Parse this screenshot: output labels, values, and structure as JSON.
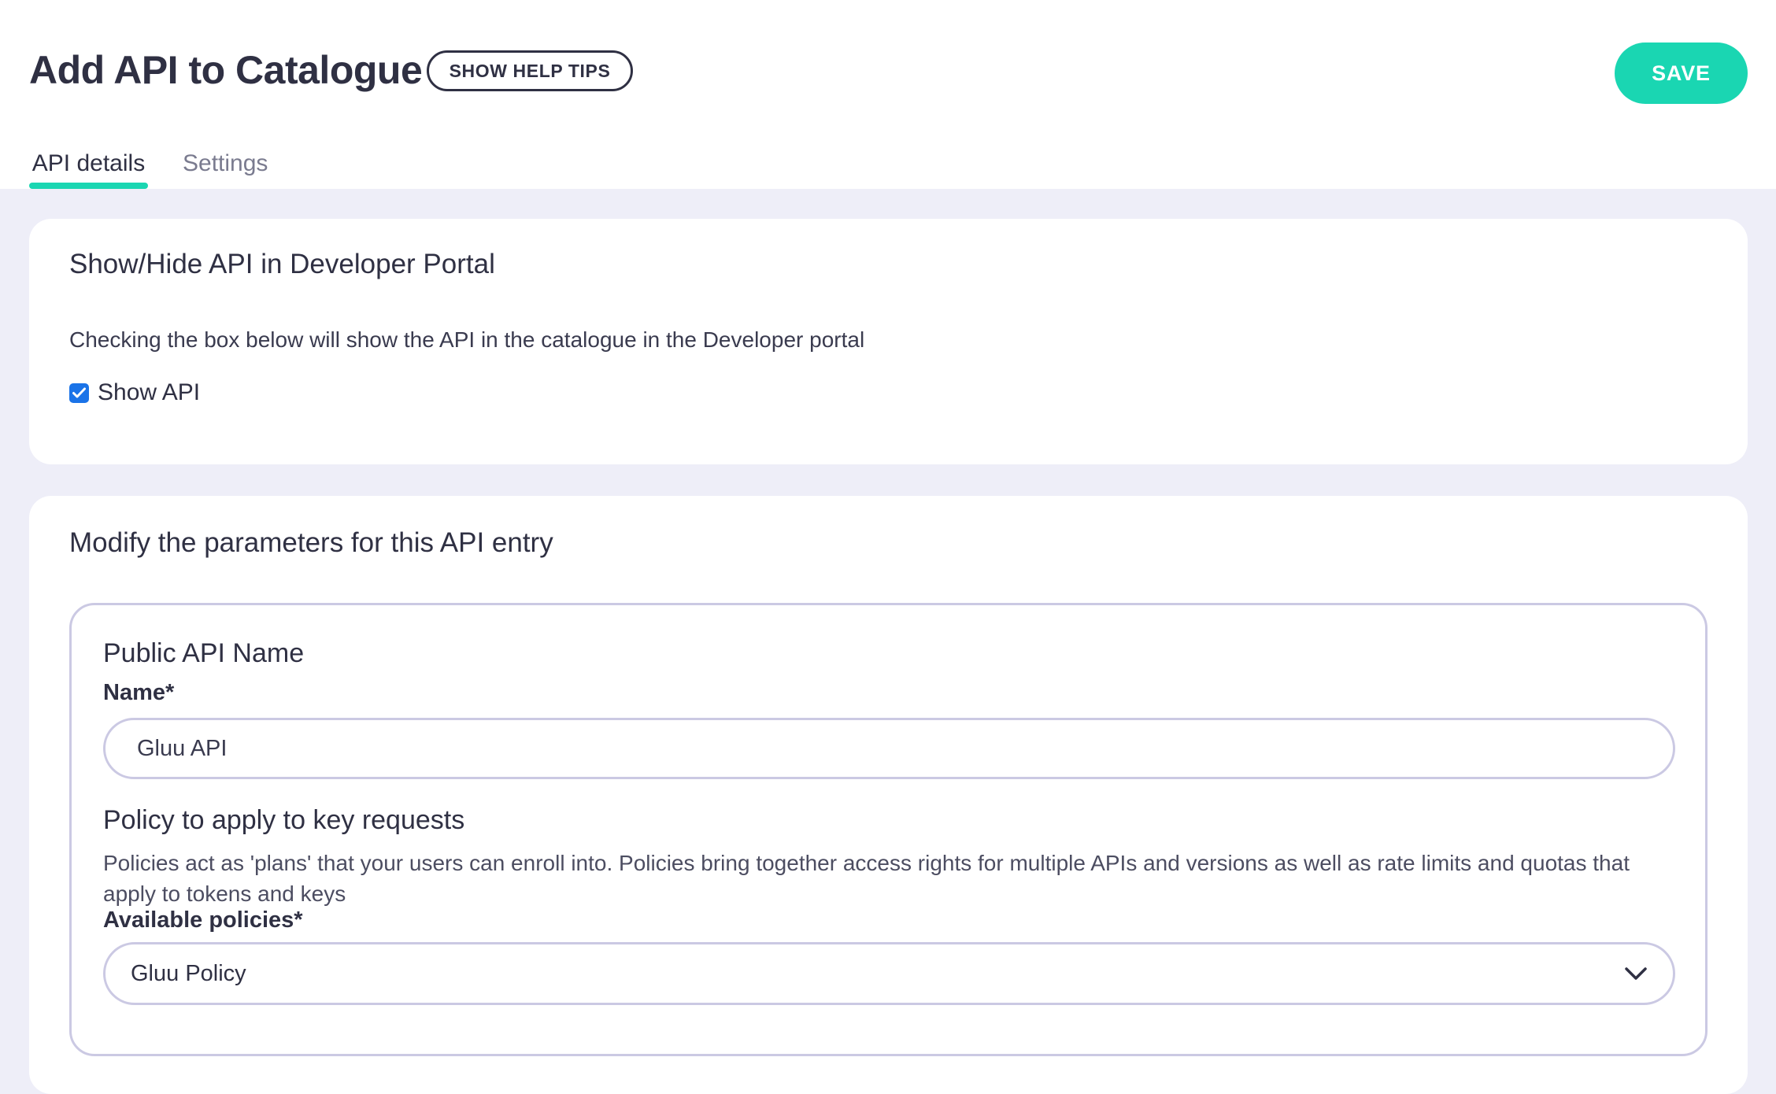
{
  "header": {
    "title": "Add API to Catalogue",
    "help_tips_label": "SHOW HELP TIPS",
    "save_label": "SAVE"
  },
  "tabs": [
    {
      "label": "API details",
      "active": true
    },
    {
      "label": "Settings",
      "active": false
    }
  ],
  "visibility_card": {
    "title": "Show/Hide API in Developer Portal",
    "description": "Checking the box below will show the API in the catalogue in the Developer portal",
    "checkbox_label": "Show API",
    "checked": true
  },
  "params_card": {
    "title": "Modify the parameters for this API entry",
    "public_name": {
      "section_title": "Public API Name",
      "field_label": "Name*",
      "value": "Gluu API"
    },
    "policy": {
      "section_title": "Policy to apply to key requests",
      "description": "Policies act as 'plans' that your users can enroll into. Policies bring together access rights for multiple APIs and versions as well as rate limits and quotas that apply to tokens and keys",
      "field_label": "Available policies*",
      "selected": "Gluu Policy"
    }
  },
  "colors": {
    "accent": "#1ad6b2",
    "checkbox": "#1a73e8",
    "page_background": "#eeeef8",
    "border": "#cbc9e3",
    "text": "#2f3043"
  },
  "icons": {
    "checkbox": "check-icon",
    "select": "chevron-down-icon"
  }
}
